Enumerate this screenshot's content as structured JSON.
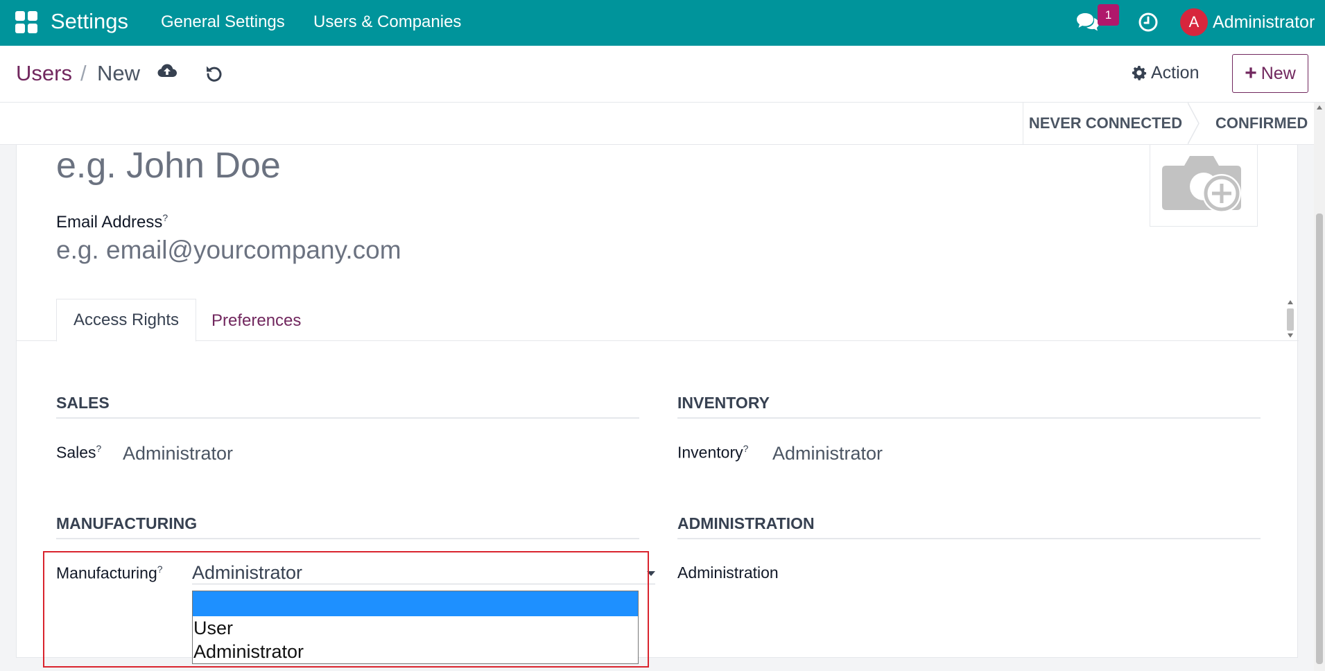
{
  "navbar": {
    "brand": "Settings",
    "menu": [
      "General Settings",
      "Users & Companies"
    ],
    "messages_badge": "1",
    "avatar_letter": "A",
    "user_name": "Administrator",
    "icons": {
      "apps": "apps-grid-icon",
      "chat": "chat-icon",
      "activity": "clock-icon"
    },
    "colors": {
      "bar": "#00949b",
      "badge": "#b0186b",
      "avatar": "#d7263d"
    }
  },
  "control_panel": {
    "breadcrumb_parent": "Users",
    "breadcrumb_separator": "/",
    "breadcrumb_current": "New",
    "action_label": "Action",
    "new_label": "New",
    "icons": {
      "save": "cloud-upload-icon",
      "discard": "undo-icon",
      "action": "gear-icon"
    },
    "accent": "#71275e"
  },
  "statusbar": {
    "steps": [
      "NEVER CONNECTED",
      "CONFIRMED"
    ]
  },
  "form": {
    "name_placeholder": "e.g. John Doe",
    "email_label": "Email Address",
    "email_placeholder": "e.g. email@yourcompany.com",
    "help_marker": "?",
    "tabs": [
      {
        "label": "Access Rights",
        "active": true
      },
      {
        "label": "Preferences",
        "active": false
      }
    ],
    "sections": {
      "sales": {
        "title": "SALES",
        "field_label": "Sales",
        "value": "Administrator"
      },
      "inventory": {
        "title": "INVENTORY",
        "field_label": "Inventory",
        "value": "Administrator"
      },
      "manufacturing": {
        "title": "MANUFACTURING",
        "field_label": "Manufacturing",
        "value": "Administrator",
        "options": [
          "",
          "User",
          "Administrator"
        ]
      },
      "administration": {
        "title": "ADMINISTRATION",
        "field_label": "Administration"
      }
    },
    "highlight_color": "#d9232d"
  }
}
